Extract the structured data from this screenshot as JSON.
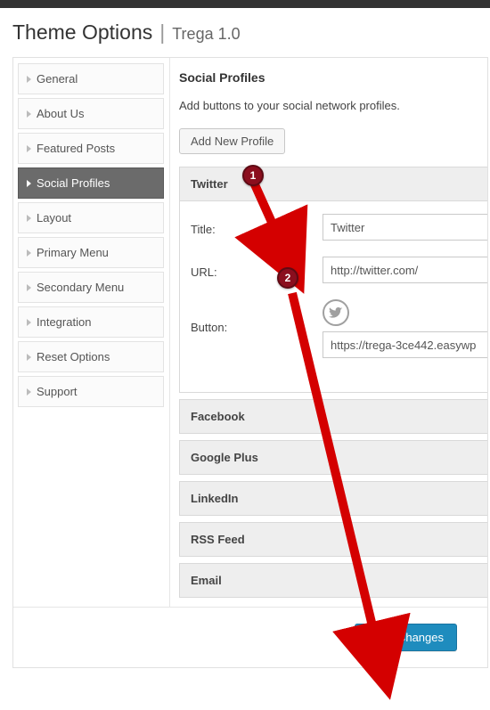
{
  "header": {
    "title": "Theme Options",
    "theme": "Trega 1.0"
  },
  "sidebar": {
    "items": [
      {
        "label": "General"
      },
      {
        "label": "About Us"
      },
      {
        "label": "Featured Posts"
      },
      {
        "label": "Social Profiles"
      },
      {
        "label": "Layout"
      },
      {
        "label": "Primary Menu"
      },
      {
        "label": "Secondary Menu"
      },
      {
        "label": "Integration"
      },
      {
        "label": "Reset Options"
      },
      {
        "label": "Support"
      }
    ]
  },
  "content": {
    "title": "Social Profiles",
    "desc": "Add buttons to your social network profiles.",
    "add_btn": "Add New Profile",
    "panels_rest": [
      {
        "label": "Facebook"
      },
      {
        "label": "Google Plus"
      },
      {
        "label": "LinkedIn"
      },
      {
        "label": "RSS Feed"
      },
      {
        "label": "Email"
      }
    ],
    "twitter": {
      "head": "Twitter",
      "title_label": "Title:",
      "title_value": "Twitter",
      "url_label": "URL:",
      "url_value": "http://twitter.com/",
      "button_label": "Button:",
      "button_value": "https://trega-3ce442.easywp"
    }
  },
  "footer": {
    "save": "Save Changes"
  },
  "annotations": {
    "b1": "1",
    "b2": "2"
  }
}
